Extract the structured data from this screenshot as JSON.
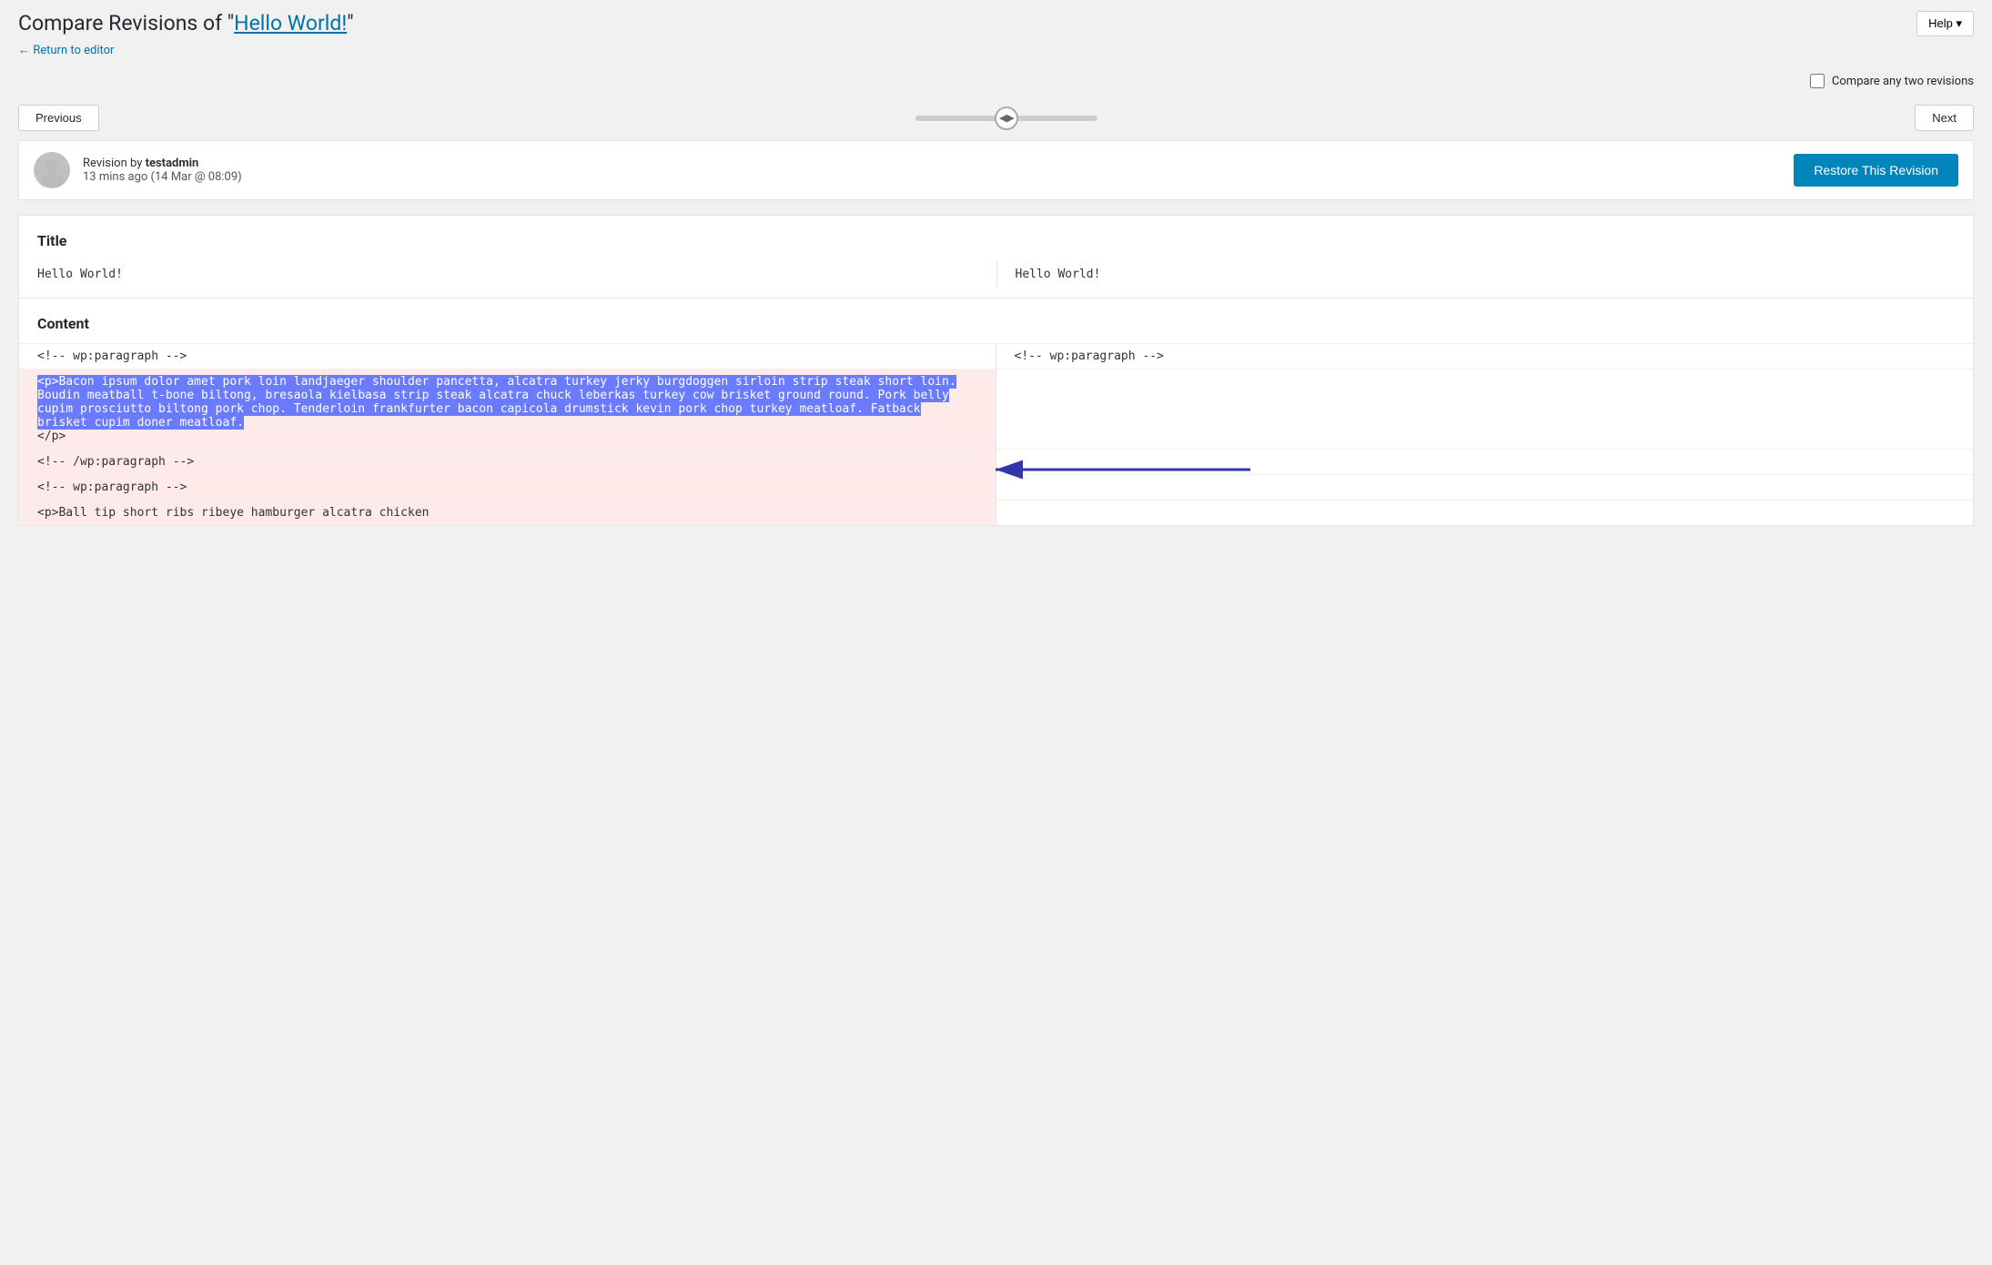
{
  "header": {
    "title_prefix": "Compare Revisions of \"",
    "title_link": "Hello World!",
    "title_suffix": "\"",
    "title_link_href": "#",
    "return_link": "← Return to editor",
    "help_label": "Help ▾"
  },
  "compare": {
    "label": "Compare any two revisions",
    "checked": false
  },
  "navigation": {
    "previous_label": "Previous",
    "next_label": "Next"
  },
  "revision": {
    "author": "testadmin",
    "prefix": "Revision by ",
    "time_ago": "13 mins ago",
    "date": "(14 Mar @ 08:09)",
    "restore_label": "Restore This Revision"
  },
  "diff": {
    "title_label": "Title",
    "content_label": "Content",
    "title_left": "Hello World!",
    "title_right": "Hello World!",
    "rows": [
      {
        "type": "normal",
        "left": "<!-- wp:paragraph -->",
        "right": "<!-- wp:paragraph -->"
      },
      {
        "type": "removed",
        "left_highlighted": true,
        "left": "<p>Bacon ipsum dolor amet pork loin landjaeger shoulder pancetta, alcatra turkey jerky burgdoggen sirloin strip steak short loin. Boudin meatball t-bone biltong, bresaola kielbasa strip steak alcatra chuck leberkas turkey cow brisket ground round. Pork belly cupim prosciutto biltong pork chop. Tenderloin frankfurter bacon capicola drumstick kevin pork chop turkey meatloaf. Fatback brisket cupim doner meatloaf.",
        "left_tail": "</p>",
        "right": ""
      },
      {
        "type": "normal",
        "left": "<!-- /wp:paragraph -->",
        "right": ""
      },
      {
        "type": "normal",
        "left": "<!-- wp:paragraph -->",
        "right": ""
      },
      {
        "type": "normal",
        "left": "<p>Ball tip short ribs ribeye hamburger alcatra chicken",
        "right": ""
      }
    ]
  },
  "cow_word": "COW"
}
